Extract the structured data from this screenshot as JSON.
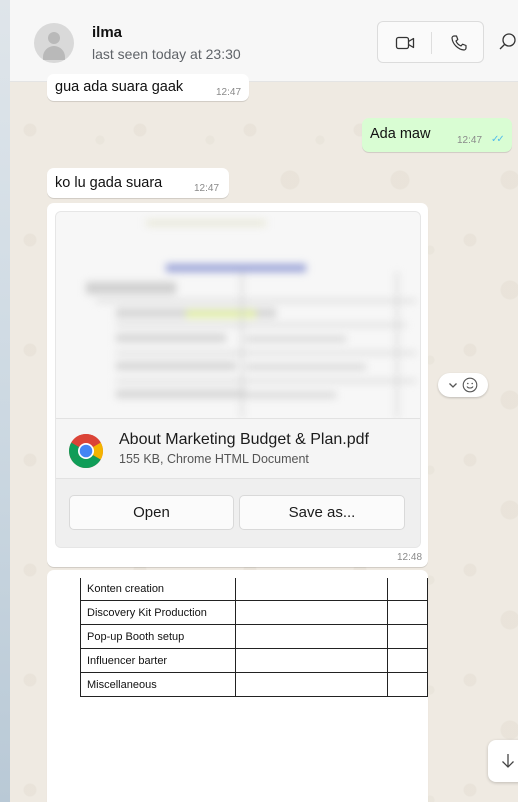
{
  "header": {
    "contact_name": "ilma",
    "status": "last seen today at 23:30",
    "video_icon": "video-camera-icon",
    "voice_icon": "phone-icon",
    "search_icon": "search-icon"
  },
  "messages": [
    {
      "direction": "in",
      "text": "gua ada suara gaak",
      "time": "12:47"
    },
    {
      "direction": "out",
      "text": "Ada maw",
      "time": "12:47",
      "status": "read"
    },
    {
      "direction": "in",
      "text": "ko lu gada suara",
      "time": "12:47"
    }
  ],
  "document": {
    "file_name": "About Marketing Budget & Plan.pdf",
    "meta": "155 KB, Chrome HTML Document",
    "app_icon": "chrome-icon",
    "open_label": "Open",
    "save_label": "Save as...",
    "time": "12:48"
  },
  "image_table": {
    "rows": [
      [
        "Konten creation",
        "",
        ""
      ],
      [
        "Discovery Kit Production",
        "",
        ""
      ],
      [
        "Pop-up Booth setup",
        "",
        ""
      ],
      [
        "Influencer barter",
        "",
        ""
      ],
      [
        "Miscellaneous",
        "",
        ""
      ]
    ]
  },
  "colors": {
    "chat_bg": "#efeae2",
    "outgoing_bubble": "#d9fdd3",
    "incoming_bubble": "#ffffff",
    "read_ticks": "#53bdeb"
  }
}
